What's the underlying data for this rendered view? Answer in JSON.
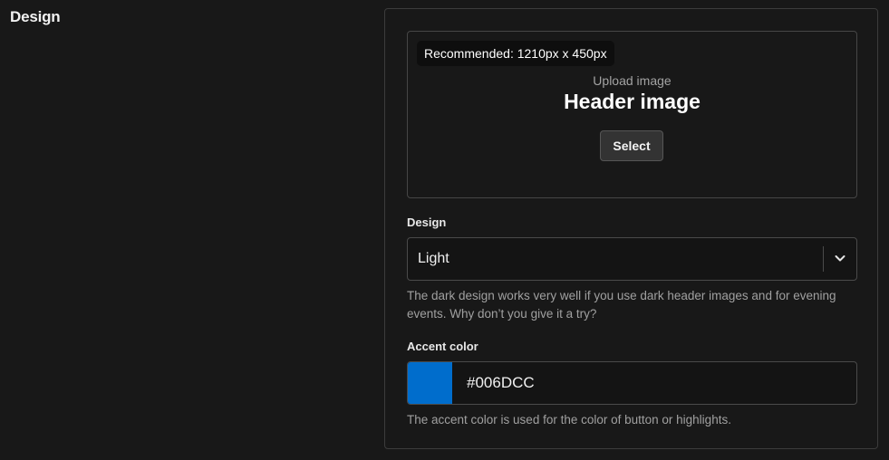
{
  "section": {
    "title": "Design"
  },
  "upload": {
    "recommended": "Recommended: 1210px x 450px",
    "subtitle": "Upload image",
    "title": "Header image",
    "select_label": "Select"
  },
  "design_field": {
    "label": "Design",
    "value": "Light",
    "help": "The dark design works very well if you use dark header images and for evening events. Why don’t you give it a try?",
    "chevron_icon": "chevron-down-icon"
  },
  "accent_field": {
    "label": "Accent color",
    "value": "#006DCC",
    "swatch_color": "#006DCC",
    "help": "The accent color is used for the color of button or highlights."
  }
}
